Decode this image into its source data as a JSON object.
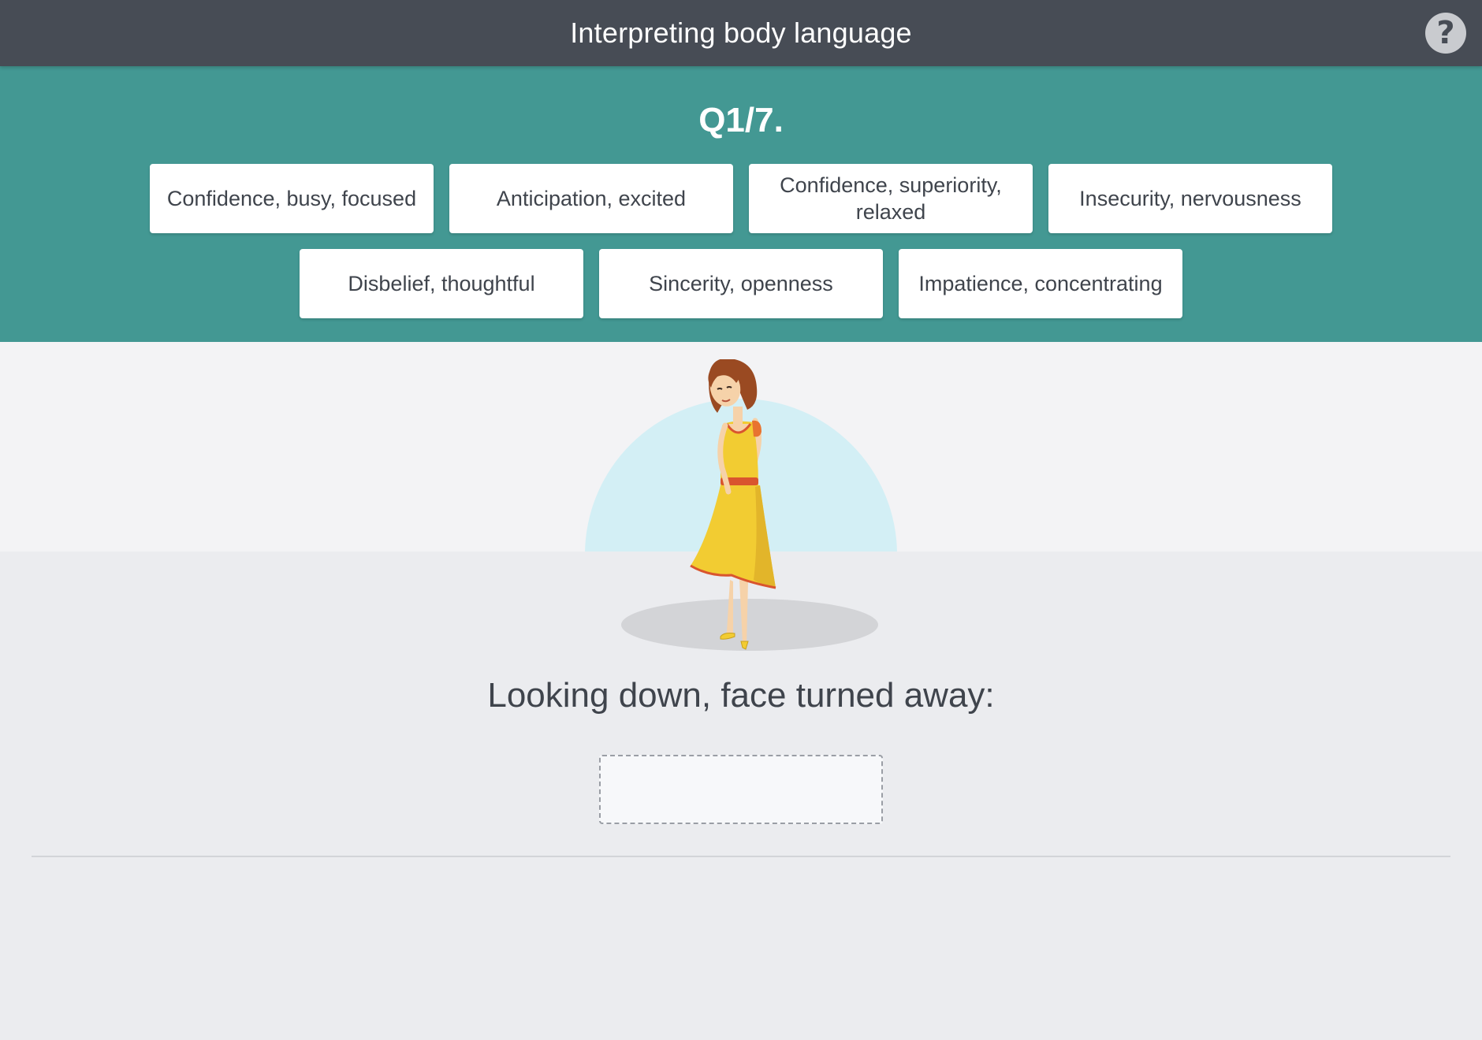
{
  "header": {
    "title": "Interpreting body language",
    "help_icon": "help-icon"
  },
  "question": {
    "number": "Q1/7.",
    "prompt": "Looking down, face turned away:",
    "answer": ""
  },
  "options": [
    {
      "label": "Confidence, busy, focused"
    },
    {
      "label": "Anticipation, excited"
    },
    {
      "label": "Confidence, superiority, relaxed"
    },
    {
      "label": "Insecurity, nervousness"
    },
    {
      "label": "Disbelief, thoughtful"
    },
    {
      "label": "Sincerity, openness"
    },
    {
      "label": "Impatience, concentrating"
    }
  ],
  "colors": {
    "header_bg": "#474c55",
    "panel_bg": "#439893",
    "stage_circle": "#d3eff5",
    "dress": "#f2cc32"
  }
}
